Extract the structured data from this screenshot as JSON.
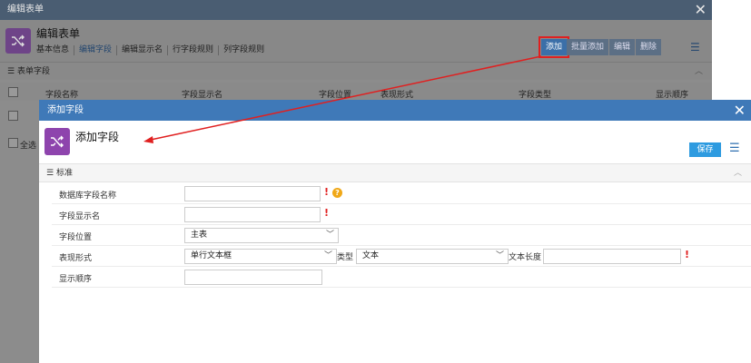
{
  "background_window": {
    "titlebar": "编辑表单",
    "title": "编辑表单",
    "tabs": [
      "基本信息",
      "编辑字段",
      "编辑显示名",
      "行字段规则",
      "列字段规则"
    ],
    "active_tab": "编辑字段",
    "buttons": {
      "add": "添加",
      "batch_add": "批量添加",
      "edit": "编辑",
      "delete": "删除"
    },
    "section_title": "表单字段",
    "grid_headers": [
      "字段名称",
      "字段显示名",
      "字段位置",
      "表现形式",
      "字段类型",
      "显示顺序"
    ],
    "select_all": "全选"
  },
  "dialog": {
    "titlebar": "添加字段",
    "title": "添加字段",
    "save_label": "保存",
    "section_title": "标准",
    "fields": {
      "db_field_name": {
        "label": "数据库字段名称",
        "value": ""
      },
      "display_name": {
        "label": "字段显示名",
        "value": ""
      },
      "position": {
        "label": "字段位置",
        "value": "主表"
      },
      "presentation": {
        "label": "表现形式",
        "value": "单行文本框"
      },
      "type": {
        "label": "类型",
        "value": "文本"
      },
      "text_length": {
        "label": "文本长度",
        "value": ""
      },
      "display_order": {
        "label": "显示顺序",
        "value": ""
      }
    }
  },
  "colors": {
    "dialog_titlebar": "#3f79b8",
    "save_button": "#2e9be0",
    "app_icon": "#8e44ad",
    "highlight": "#e02020"
  }
}
